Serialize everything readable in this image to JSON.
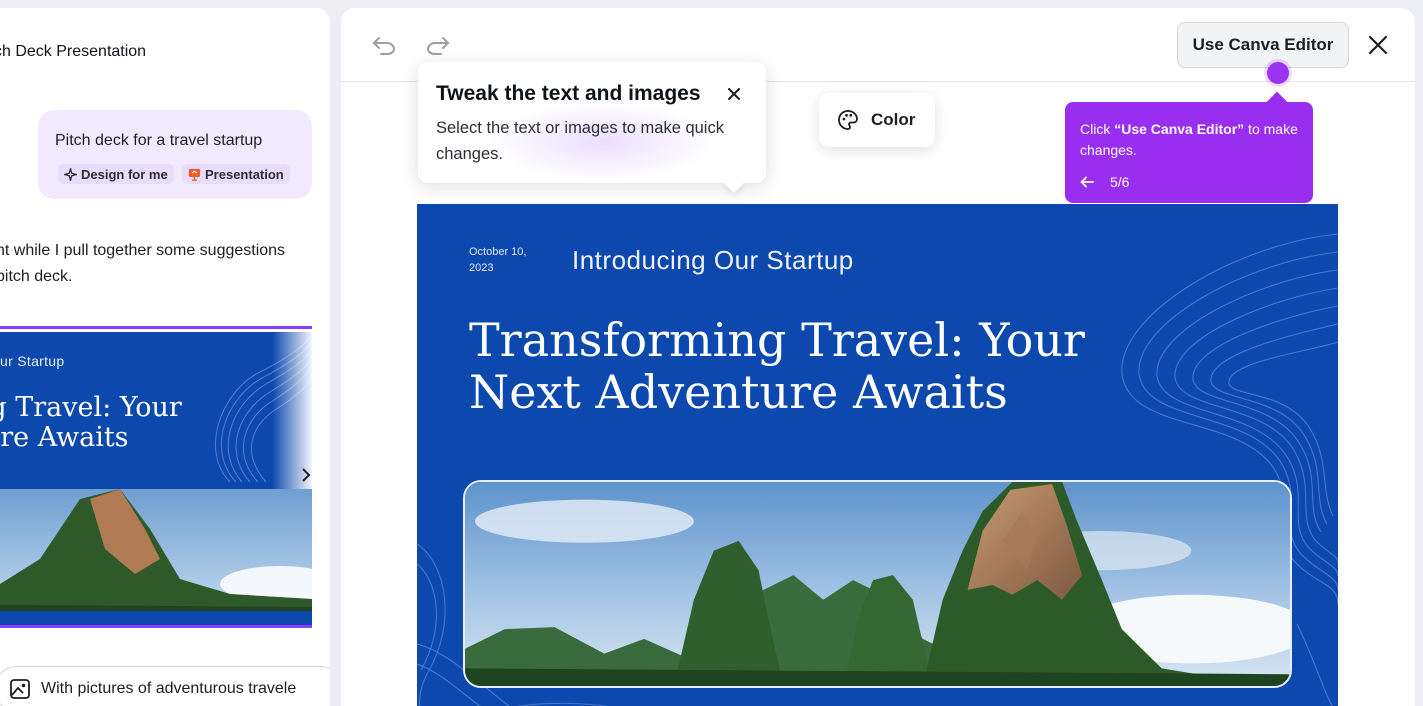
{
  "chat": {
    "title": "ch Deck Presentation",
    "prompt": "Pitch deck for a travel startup",
    "chips": [
      "Design for me",
      "Presentation"
    ],
    "reply_lines": [
      "nt while I pull together some suggestions",
      "pitch deck."
    ],
    "thumbnail": {
      "subtitle": "ur Startup",
      "title_lines": [
        "ng Travel: Your",
        "ture Awaits"
      ]
    },
    "next_prompt": "With pictures of adventurous travele"
  },
  "toolbar": {
    "use_editor_label": "Use Canva Editor"
  },
  "tip": {
    "title": "Tweak the text and images",
    "body": "Select the text or images to make quick changes."
  },
  "color_button": {
    "label": "Color"
  },
  "guide": {
    "prefix": "Click ",
    "highlight": "“Use Canva Editor”",
    "suffix": " to make changes.",
    "step": "5/6"
  },
  "slide": {
    "date": "October 10, 2023",
    "subtitle": "Introducing Our Startup",
    "title_lines": [
      "Transforming Travel: Your",
      "Next Adventure Awaits"
    ]
  },
  "colors": {
    "accent": "#8b3dff",
    "slide_blue": "#0c48ae",
    "guide_purple": "#9a2ef0"
  }
}
